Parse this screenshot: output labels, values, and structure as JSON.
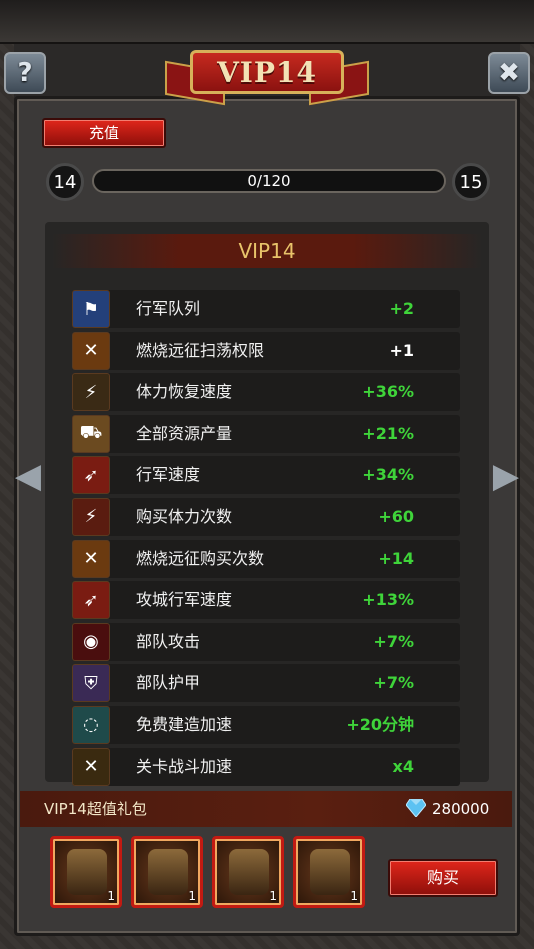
{
  "title": "VIP14",
  "recharge_label": "充值",
  "progress": {
    "current_level": "14",
    "next_level": "15",
    "text": "0/120",
    "fraction": 0
  },
  "panel_title": "VIP14",
  "privileges": [
    {
      "label": "行军队列",
      "value": "+2",
      "icon": "march-queue-icon",
      "value_color": "#3fd43a"
    },
    {
      "label": "燃烧远征扫荡权限",
      "value": "+1",
      "icon": "axes-icon",
      "value_color": "#ffffff"
    },
    {
      "label": "体力恢复速度",
      "value": "+36%",
      "icon": "stamina-recovery-icon",
      "value_color": "#3fd43a"
    },
    {
      "label": "全部资源产量",
      "value": "+21%",
      "icon": "resource-cart-icon",
      "value_color": "#3fd43a"
    },
    {
      "label": "行军速度",
      "value": "+34%",
      "icon": "march-speed-icon",
      "value_color": "#3fd43a"
    },
    {
      "label": "购买体力次数",
      "value": "+60",
      "icon": "buy-stamina-icon",
      "value_color": "#3fd43a"
    },
    {
      "label": "燃烧远征购买次数",
      "value": "+14",
      "icon": "axes-plus-icon",
      "value_color": "#3fd43a"
    },
    {
      "label": "攻城行军速度",
      "value": "+13%",
      "icon": "siege-speed-icon",
      "value_color": "#3fd43a"
    },
    {
      "label": "部队攻击",
      "value": "+7%",
      "icon": "troop-attack-icon",
      "value_color": "#3fd43a"
    },
    {
      "label": "部队护甲",
      "value": "+7%",
      "icon": "troop-armor-icon",
      "value_color": "#3fd43a"
    },
    {
      "label": "免费建造加速",
      "value": "+20分钟",
      "icon": "build-speedup-icon",
      "value_color": "#3fd43a"
    },
    {
      "label": "关卡战斗加速",
      "value": "x4",
      "icon": "crossed-swords-icon",
      "value_color": "#3fd43a"
    }
  ],
  "gift": {
    "title": "VIP14超值礼包",
    "price": "280000",
    "items": [
      {
        "name": "helmet-item",
        "count": "1"
      },
      {
        "name": "chest-armor-item",
        "count": "1"
      },
      {
        "name": "shoulder-armor-item",
        "count": "1"
      },
      {
        "name": "gauntlet-item",
        "count": "1"
      }
    ],
    "buy_label": "购买"
  },
  "icons": {
    "help": "?",
    "close": "✖",
    "prev": "◀",
    "next": "▶"
  },
  "colors": {
    "accent_red": "#c21a12",
    "title_gold": "#e8c36a",
    "value_green": "#3fd43a"
  }
}
